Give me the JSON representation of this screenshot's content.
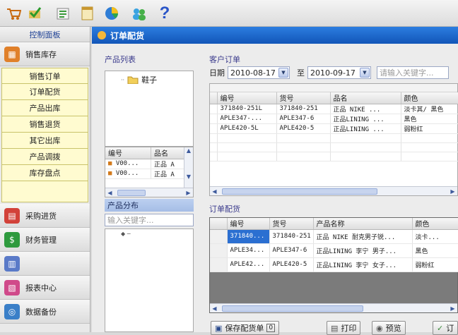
{
  "toolbar": {
    "icons": [
      "cart-icon",
      "check-icon",
      "list-icon",
      "book-icon",
      "pie-icon",
      "users-icon",
      "help-icon"
    ]
  },
  "nav": {
    "title": "控制面板",
    "group_sales": "销售库存",
    "sub_items": [
      "销售订单",
      "订单配货",
      "产品出库",
      "销售退货",
      "其它出库",
      "产品调拨",
      "库存盘点"
    ],
    "groups_bottom": [
      "采购进货",
      "财务管理",
      "",
      "报表中心",
      "数据备份"
    ]
  },
  "main": {
    "title": "订单配货",
    "product_list_label": "产品列表",
    "tree_node": "鞋子",
    "product_grid": {
      "headers": [
        "编号",
        "品名"
      ],
      "rows": [
        [
          "V00...",
          "正品 A"
        ],
        [
          "V00...",
          "正品 A"
        ]
      ]
    },
    "distribution_label": "产品分布",
    "distribution_search_placeholder": "输入关键字...",
    "customer_orders_label": "客户订单",
    "date_label": "日期",
    "date_from": "2010-08-17",
    "to_label": "至",
    "date_to": "2010-09-17",
    "order_search_placeholder": "请输入关键字...",
    "orders_grid": {
      "headers": [
        "编号",
        "货号",
        "品名",
        "颜色"
      ],
      "rows": [
        [
          "371840-251L",
          "371840-251",
          "正品 NIKE ...",
          "淡卡其/ 黑色"
        ],
        [
          "APLE347-...",
          "APLE347-6",
          "正品LINING ...",
          "黑色"
        ],
        [
          "APLE420-5L",
          "APLE420-5",
          "正品LINING ...",
          "弱粉红"
        ]
      ]
    },
    "allocation_label": "订单配货",
    "allocation_grid": {
      "headers": [
        "编号",
        "货号",
        "产品名称",
        "颜色"
      ],
      "rows": [
        [
          "371840...",
          "371840-251",
          "正品 NIKE 耐克男子锐...",
          "淡卡..."
        ],
        [
          "APLE34...",
          "APLE347-6",
          "正品LINING 李宁 男子...",
          "黑色"
        ],
        [
          "APLE42...",
          "APLE420-5",
          "正品LINING 李宁 女子...",
          "弱粉红"
        ]
      ]
    },
    "buttons": {
      "save": "保存配货单",
      "print": "打印",
      "preview": "预览",
      "more": "订"
    }
  }
}
